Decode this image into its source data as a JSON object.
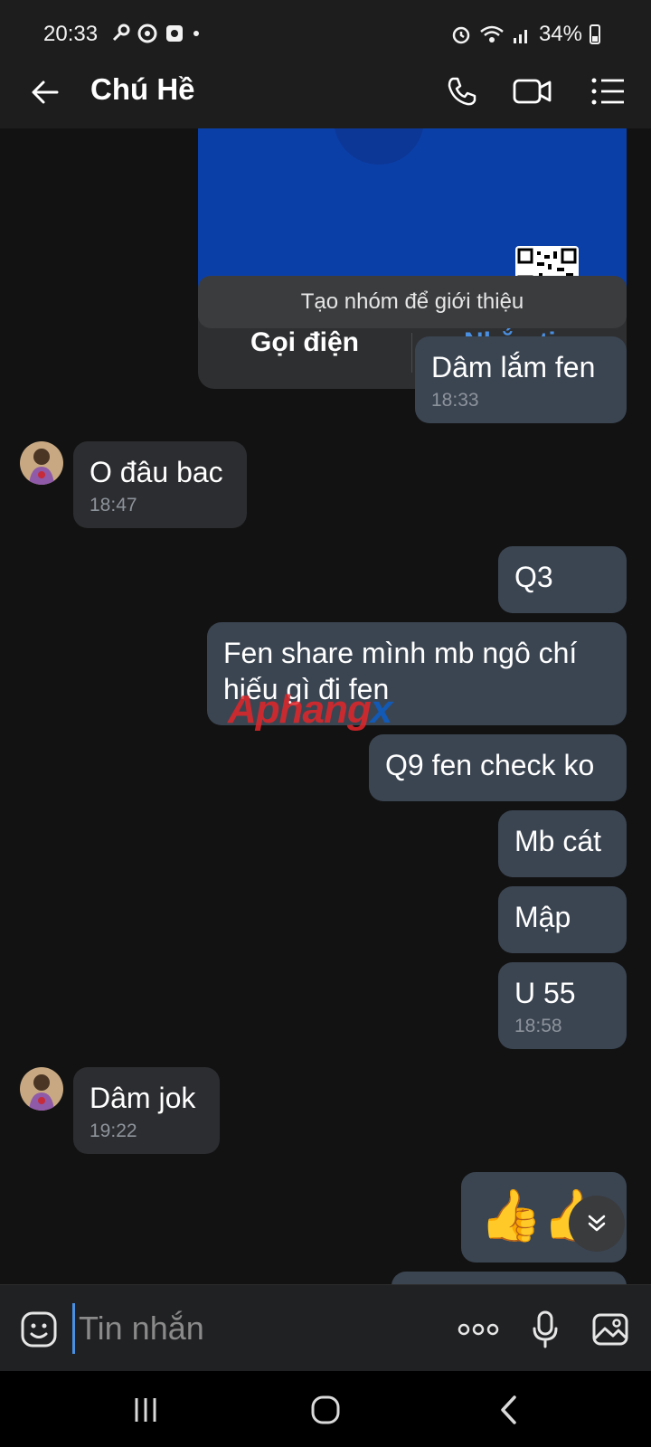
{
  "status_bar": {
    "time": "20:33",
    "battery": "34%"
  },
  "header": {
    "contact_name": "Chú Hề"
  },
  "contact_card": {
    "call_label": "Gọi điện",
    "message_label": "Nhắn tin"
  },
  "system_message": "Tạo nhóm để giới thiệu",
  "messages": [
    {
      "dir": "out",
      "text": "Dâm lắm fen",
      "time": "18:33"
    },
    {
      "dir": "in",
      "text": "O đâu bac",
      "time": "18:47"
    },
    {
      "dir": "out",
      "text": "Q3"
    },
    {
      "dir": "out",
      "line1": "Fen share mình mb ngô chí",
      "line2": "hiếu gì đi fen"
    },
    {
      "dir": "out",
      "text": "Q9 fen check ko"
    },
    {
      "dir": "out",
      "text": "Mb cát"
    },
    {
      "dir": "out",
      "text": "Mập"
    },
    {
      "dir": "out",
      "text": "U 55",
      "time": "18:58"
    },
    {
      "dir": "in",
      "text": "Dâm jok",
      "time": "19:22"
    },
    {
      "dir": "out",
      "emoji": "👍👍"
    }
  ],
  "watermark": {
    "part1": "Aphang",
    "part2": "x"
  },
  "composer": {
    "placeholder": "Tin nhắn"
  },
  "icons": {
    "back": "arrow-left-icon",
    "call": "phone-icon",
    "video": "video-icon",
    "menu": "list-menu-icon",
    "emoji": "emoji-icon",
    "more": "more-dots-icon",
    "mic": "microphone-icon",
    "gallery": "image-icon",
    "scroll": "chevron-double-down-icon"
  },
  "colors": {
    "accent": "#4a90e2",
    "outgoing_bubble": "#3b4552",
    "incoming_bubble": "#2c2d30",
    "background": "#121212"
  }
}
